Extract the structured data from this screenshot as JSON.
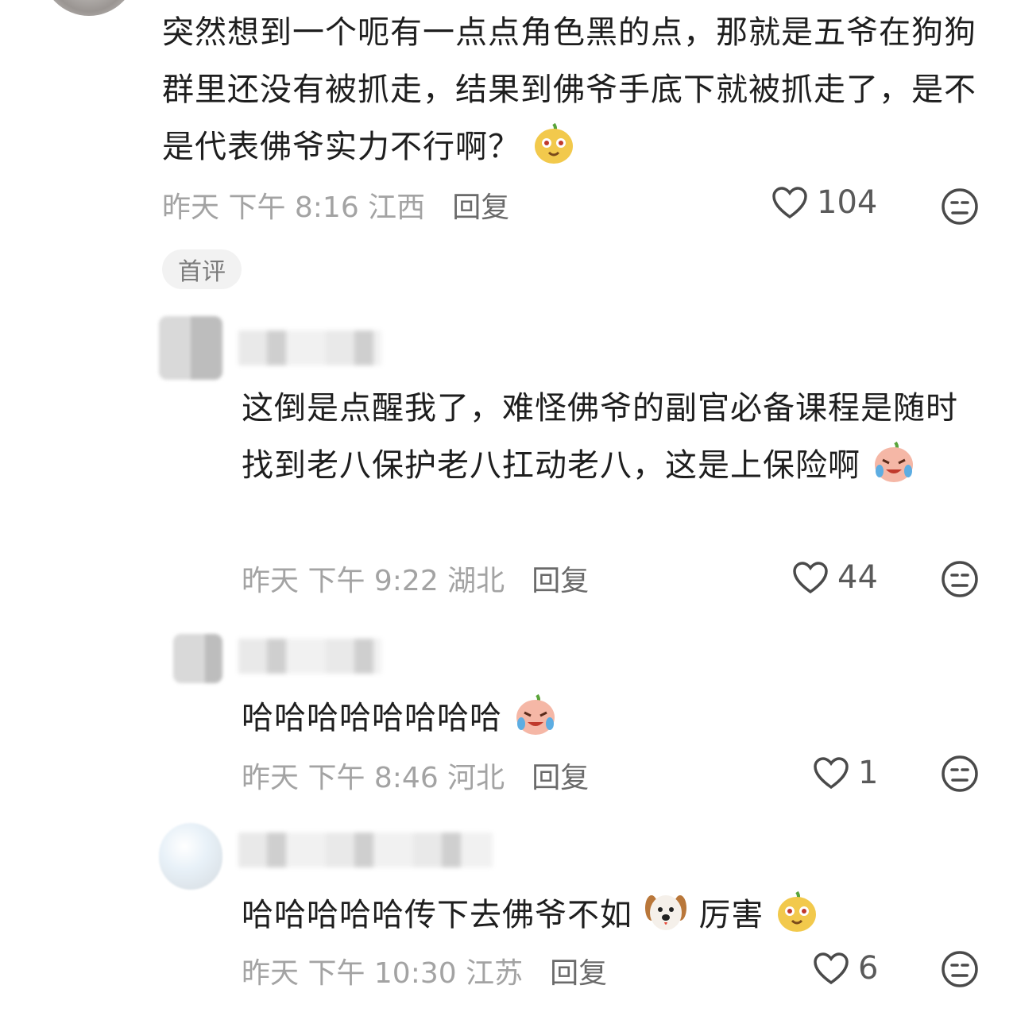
{
  "comments": [
    {
      "text": "突然想到一个呃有一点点角色黑的点，那就是五爷在狗狗群里还没有被抓走，结果到佛爷手底下就被抓走了，是不是代表佛爷实力不行啊？",
      "time": "昨天 下午 8:16 江西",
      "reply": "回复",
      "likes": "104",
      "tag": "首评"
    },
    {
      "text": "这倒是点醒我了，难怪佛爷的副官必备课程是随时找到老八保护老八扛动老八，这是上保险啊",
      "time": "昨天 下午 9:22 湖北",
      "reply": "回复",
      "likes": "44"
    },
    {
      "text": "哈哈哈哈哈哈哈哈",
      "time": "昨天 下午 8:46 河北",
      "reply": "回复",
      "likes": "1"
    },
    {
      "text_a": "哈哈哈哈哈传下去佛爷不如",
      "text_b": "厉害",
      "time": "昨天 下午 10:30 江苏",
      "reply": "回复",
      "likes": "6"
    }
  ],
  "icons": {
    "like": "heart-outline-icon",
    "dislike": "neutral-face-icon",
    "emoji_melon": "melon-face-emoji",
    "emoji_laugh_cry": "laugh-cry-emoji",
    "emoji_dog": "dog-face-emoji"
  },
  "colors": {
    "meta": "#a3a3a3",
    "text": "#1e1e1e",
    "tag_bg": "#f2f2f2"
  }
}
